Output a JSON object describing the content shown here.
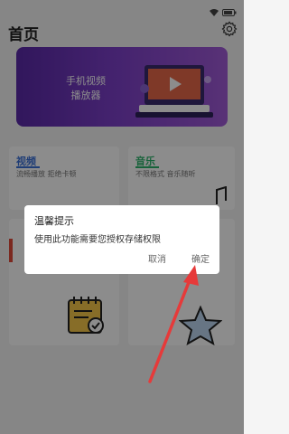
{
  "header": {
    "title": "首页"
  },
  "banner": {
    "line1": "手机视频",
    "line2": "播放器"
  },
  "cards": [
    {
      "title": "视频",
      "subtitle": "流畅播放 拒绝卡顿",
      "accent": "#3a6fd8"
    },
    {
      "title": "音乐",
      "subtitle": "不限格式 音乐随听",
      "accent": "#2bb36a"
    }
  ],
  "dialog": {
    "title": "温馨提示",
    "message": "使用此功能需要您授权存储权限",
    "cancel_label": "取消",
    "ok_label": "确定"
  },
  "colors": {
    "arrow": "#e63a3a",
    "banner_start": "#5a2aa8",
    "banner_end": "#a15bd8"
  }
}
